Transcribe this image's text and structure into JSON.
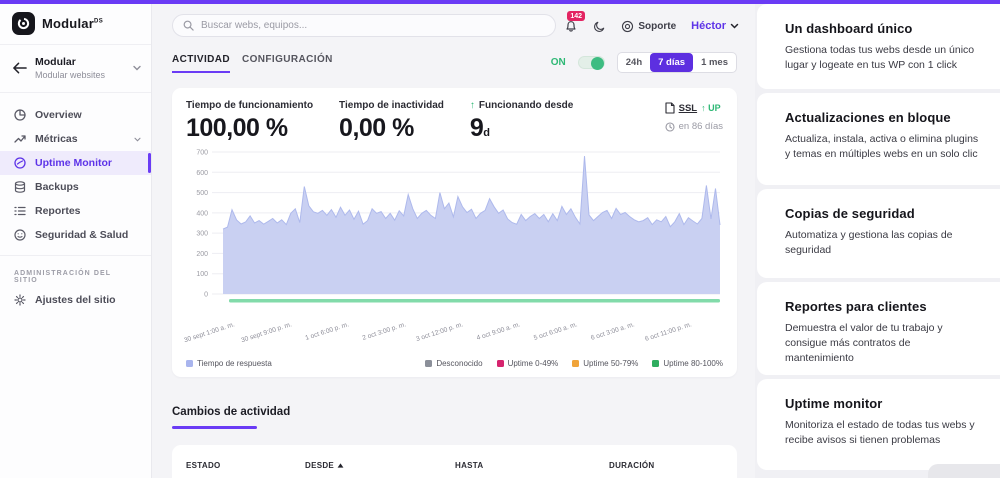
{
  "colors": {
    "accent": "#6a3bf5",
    "accent_dark": "#5d2fe0",
    "green": "#2eb875",
    "toggle_green": "#3ebc82",
    "badge_red": "#e32462",
    "area_fill": "#c9d0f2",
    "area_stroke": "#aeb9ec",
    "grid": "#ededf2",
    "tick_text": "#9b9ba3",
    "strip_green": "#82dbaa"
  },
  "sidebar": {
    "logo_text": "Modular",
    "logo_badge": "DS",
    "site": {
      "name": "Modular",
      "subtitle": "Modular websites"
    },
    "items": [
      {
        "label": "Overview"
      },
      {
        "label": "Métricas"
      },
      {
        "label": "Uptime Monitor"
      },
      {
        "label": "Backups"
      },
      {
        "label": "Reportes"
      },
      {
        "label": "Seguridad & Salud"
      }
    ],
    "section_label": "ADMINISTRACIÓN DEL SITIO",
    "settings_label": "Ajustes del sitio"
  },
  "topbar": {
    "search_placeholder": "Buscar webs, equipos...",
    "notification_count": "142",
    "support_label": "Soporte",
    "user_name": "Héctor"
  },
  "tabs": {
    "activity": "ACTIVIDAD",
    "configuration": "CONFIGURACIÓN"
  },
  "monitor_toggle": {
    "label": "ON"
  },
  "ranges": [
    {
      "label": "24h"
    },
    {
      "label": "7 días"
    },
    {
      "label": "1 mes"
    }
  ],
  "stats": {
    "uptime": {
      "label": "Tiempo de funcionamiento",
      "value": "100,00 %"
    },
    "downtime": {
      "label": "Tiempo de inactividad",
      "value": "0,00 %"
    },
    "since": {
      "label": "Funcionando desde",
      "value": "9",
      "unit": "d",
      "arrow": "↑"
    },
    "ssl": {
      "label": "SSL",
      "status_arrow": "↑",
      "status": "UP",
      "renew": "en 86 días"
    }
  },
  "chart_data": {
    "type": "area",
    "title": "",
    "xlabel": "",
    "ylabel": "",
    "ylim": [
      0,
      700
    ],
    "yticks": [
      0,
      100,
      200,
      300,
      400,
      500,
      600,
      700
    ],
    "grid": true,
    "legend_position": "bottom",
    "x_tick_labels": [
      "30 sept 1:00 a. m.",
      "30 sept 9:00 p. m.",
      "1 oct 6:00 p. m.",
      "2 oct 3:00 p. m.",
      "3 oct 12:00 p. m.",
      "4 oct 9:00 a. m.",
      "5 oct 6:00 a. m.",
      "6 oct 3:00 a. m.",
      "6 oct 11:00 p. m."
    ],
    "series": [
      {
        "name": "Tiempo de respuesta",
        "color": "#c9d0f2",
        "values": [
          320,
          330,
          415,
          365,
          345,
          355,
          385,
          350,
          362,
          344,
          358,
          372,
          350,
          366,
          342,
          398,
          420,
          352,
          530,
          435,
          405,
          398,
          412,
          388,
          416,
          378,
          428,
          388,
          414,
          368,
          408,
          344,
          362,
          420,
          398,
          406,
          372,
          398,
          364,
          410,
          385,
          490,
          420,
          372,
          398,
          412,
          388,
          372,
          500,
          420,
          448,
          380,
          480,
          430,
          402,
          418,
          372,
          398,
          412,
          470,
          430,
          398,
          414,
          370,
          352,
          344,
          392,
          362,
          382,
          396,
          372,
          392,
          356,
          396,
          362,
          432,
          392,
          420,
          378,
          345,
          680,
          390,
          362,
          382,
          402,
          412,
          372,
          422,
          392,
          402,
          382,
          366,
          356,
          362,
          376,
          342,
          366,
          356,
          382,
          332,
          356,
          396,
          342,
          376,
          360,
          345,
          372,
          535,
          370,
          520,
          340
        ]
      }
    ],
    "uptime_strip": {
      "color": "#82dbaa",
      "meaning": "Uptime 80-100%"
    },
    "legend_left": [
      {
        "name": "Tiempo de respuesta",
        "color": "#a9b5ee"
      }
    ],
    "legend_right": [
      {
        "name": "Desconocido",
        "color": "#8b8f99"
      },
      {
        "name": "Uptime 0-49%",
        "color": "#d6246e"
      },
      {
        "name": "Uptime 50-79%",
        "color": "#f0a43a"
      },
      {
        "name": "Uptime 80-100%",
        "color": "#2fad5f"
      }
    ]
  },
  "activity_table": {
    "title": "Cambios de actividad",
    "columns": [
      {
        "label": "ESTADO",
        "sorted": false
      },
      {
        "label": "DESDE",
        "sorted": true
      },
      {
        "label": "HASTA",
        "sorted": false
      },
      {
        "label": "DURACIÓN",
        "sorted": false
      }
    ]
  },
  "promo_cards": [
    {
      "title": "Un dashboard único",
      "body": "Gestiona todas tus webs desde un único lugar y logeate en tus WP con 1 click",
      "top": 0,
      "height": 85
    },
    {
      "title": "Actualizaciones en bloque",
      "body": "Actualiza, instala, activa o elimina plugins y temas en múltiples webs en un solo clic",
      "top": 89,
      "height": 92
    },
    {
      "title": "Copias de seguridad",
      "body": "Automatiza y gestiona las copias de seguridad",
      "top": 185,
      "height": 89
    },
    {
      "title": "Reportes para clientes",
      "body": "Demuestra el valor de tu trabajo y consigue más contratos de mantenimiento",
      "top": 278,
      "height": 93
    },
    {
      "title": "Uptime monitor",
      "body": "Monitoriza el estado de todas tus webs y recibe avisos si tienen problemas",
      "top": 375,
      "height": 91
    }
  ]
}
